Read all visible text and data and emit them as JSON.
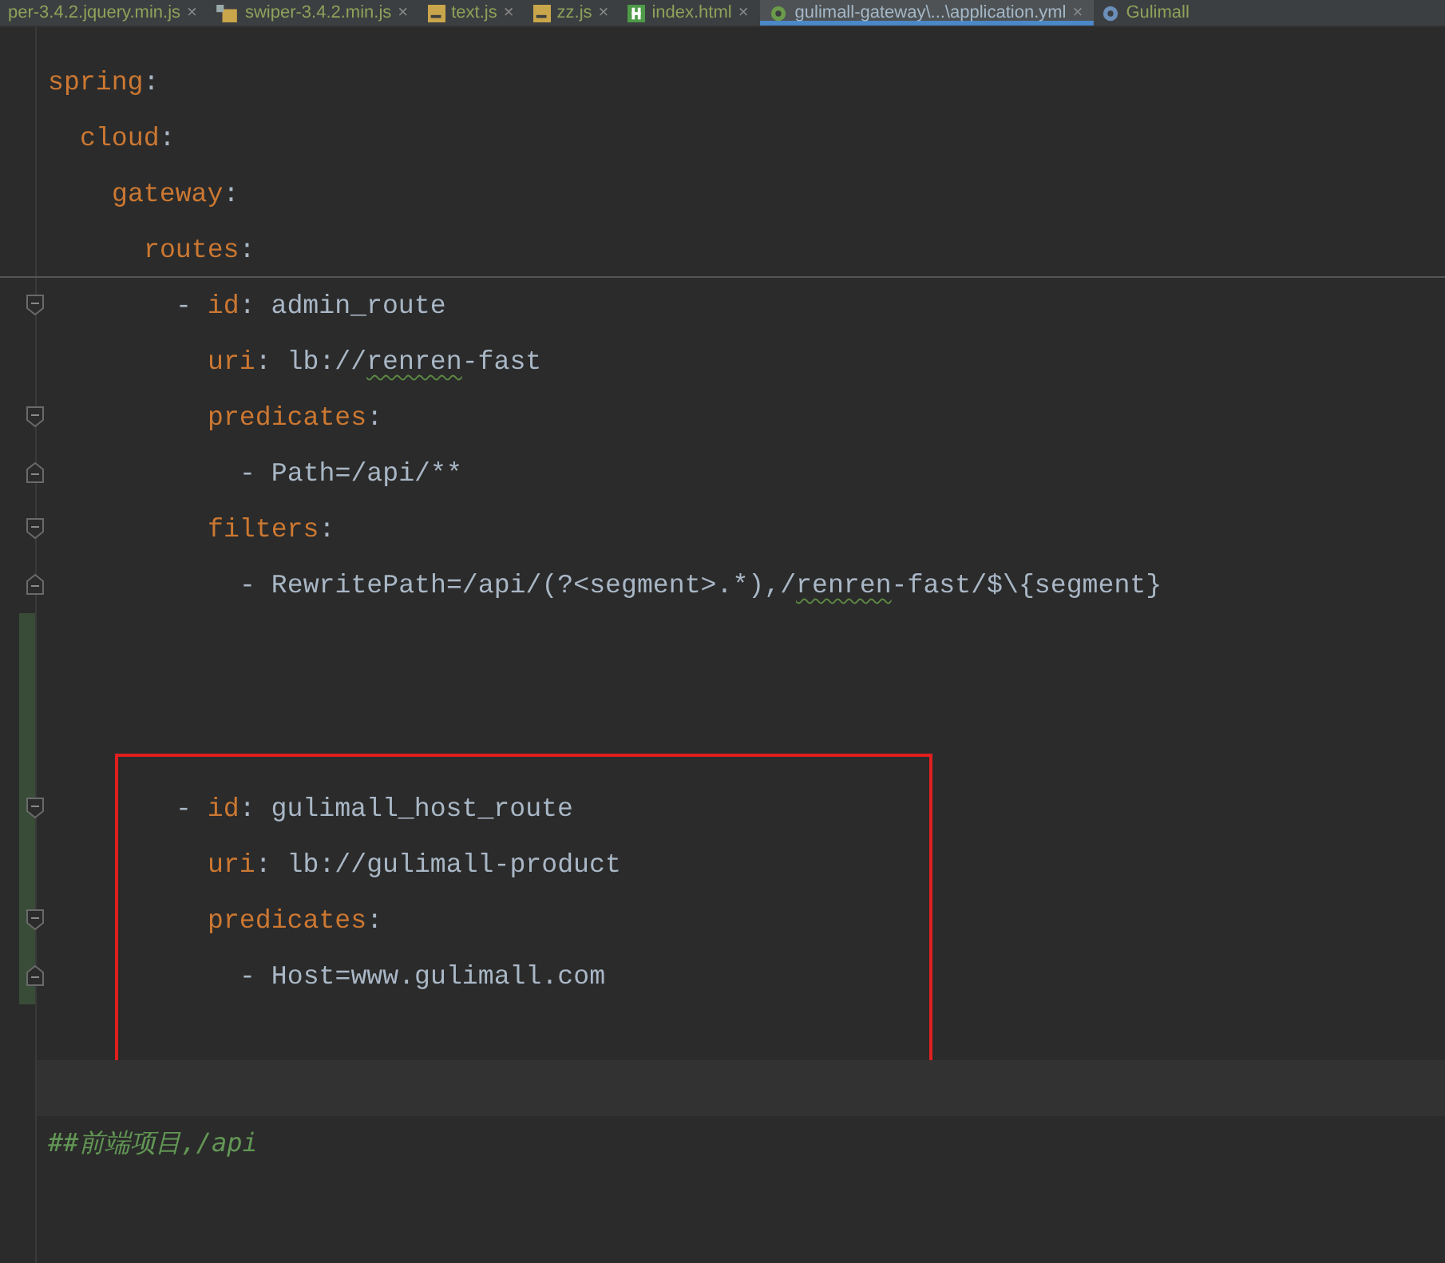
{
  "tabs": [
    {
      "label": "per-3.4.2.jquery.min.js",
      "kind": "none",
      "close": "×",
      "selected": false
    },
    {
      "label": "swiper-3.4.2.min.js",
      "kind": "minjs",
      "close": "×",
      "selected": false
    },
    {
      "label": "text.js",
      "kind": "js",
      "close": "×",
      "selected": false
    },
    {
      "label": "zz.js",
      "kind": "js",
      "close": "×",
      "selected": false
    },
    {
      "label": "index.html",
      "kind": "html",
      "close": "×",
      "selected": false
    },
    {
      "label": "gulimall-gateway\\...\\application.yml",
      "kind": "yml",
      "close": "×",
      "selected": true
    },
    {
      "label": "Gulimall",
      "kind": "app",
      "selected": false
    }
  ],
  "lines": [
    {
      "segments": [
        {
          "kind": "key",
          "text": "spring"
        },
        {
          "kind": "punct",
          "text": ":"
        }
      ],
      "children": [
        {
          "segments": [
            {
              "kind": "key",
              "text": "cloud"
            },
            {
              "kind": "punct",
              "text": ":"
            }
          ],
          "children": [
            {
              "segments": [
                {
                  "kind": "key",
                  "text": "gateway"
                },
                {
                  "kind": "punct",
                  "text": ":"
                }
              ],
              "children": [
                {
                  "segments": [
                    {
                      "kind": "key",
                      "text": "routes"
                    },
                    {
                      "kind": "punct",
                      "text": ":"
                    }
                  ],
                  "divider_below": true,
                  "children": [
                    {
                      "segments": [
                        {
                          "kind": "punct",
                          "text": "- "
                        },
                        {
                          "kind": "key",
                          "text": "id"
                        },
                        {
                          "kind": "punct",
                          "text": ": "
                        },
                        {
                          "kind": "value",
                          "text": "admin_route"
                        }
                      ],
                      "fold_start": true,
                      "children": [
                        {
                          "segments": [
                            {
                              "kind": "key",
                              "text": "uri"
                            },
                            {
                              "kind": "punct",
                              "text": ": "
                            },
                            {
                              "kind": "value",
                              "text": "lb://"
                            },
                            {
                              "kind": "typo",
                              "text": "renren"
                            },
                            {
                              "kind": "value",
                              "text": "-fast"
                            }
                          ]
                        },
                        {
                          "segments": [
                            {
                              "kind": "key",
                              "text": "predicates"
                            },
                            {
                              "kind": "punct",
                              "text": ":"
                            }
                          ],
                          "fold_start": true,
                          "children": [
                            {
                              "segments": [
                                {
                                  "kind": "punct",
                                  "text": "- "
                                },
                                {
                                  "kind": "value",
                                  "text": "Path=/api/**"
                                }
                              ],
                              "fold_end": true
                            }
                          ]
                        },
                        {
                          "segments": [
                            {
                              "kind": "key",
                              "text": "filters"
                            },
                            {
                              "kind": "punct",
                              "text": ":"
                            }
                          ],
                          "fold_start": true,
                          "children": [
                            {
                              "segments": [
                                {
                                  "kind": "punct",
                                  "text": "- "
                                },
                                {
                                  "kind": "value",
                                  "text": "RewritePath=/api/(?<segment>.*),/"
                                },
                                {
                                  "kind": "typo",
                                  "text": "renren"
                                },
                                {
                                  "kind": "value",
                                  "text": "-fast/$\\{segment}"
                                }
                              ],
                              "fold_end": true
                            }
                          ]
                        }
                      ]
                    },
                    {
                      "changed": true
                    },
                    {
                      "changed": true
                    },
                    {
                      "changed": true
                    },
                    {
                      "segments": [
                        {
                          "kind": "punct",
                          "text": "- "
                        },
                        {
                          "kind": "key",
                          "text": "id"
                        },
                        {
                          "kind": "punct",
                          "text": ": "
                        },
                        {
                          "kind": "value",
                          "text": "gulimall_host_route"
                        }
                      ],
                      "fold_start": true,
                      "changed": true,
                      "boxed": true,
                      "children": [
                        {
                          "segments": [
                            {
                              "kind": "key",
                              "text": "uri"
                            },
                            {
                              "kind": "punct",
                              "text": ": "
                            },
                            {
                              "kind": "value",
                              "text": "lb://gulimall-product"
                            }
                          ],
                          "changed": true,
                          "boxed": true
                        },
                        {
                          "segments": [
                            {
                              "kind": "key",
                              "text": "predicates"
                            },
                            {
                              "kind": "punct",
                              "text": ":"
                            }
                          ],
                          "fold_start": true,
                          "changed": true,
                          "boxed": true,
                          "children": [
                            {
                              "segments": [
                                {
                                  "kind": "punct",
                                  "text": "- "
                                },
                                {
                                  "kind": "value",
                                  "text": "Host=www.gulimall.com"
                                }
                              ],
                              "fold_end": true,
                              "changed": true,
                              "boxed": true
                            }
                          ]
                        }
                      ]
                    },
                    {
                      "boxed": true
                    },
                    {
                      "boxed": true,
                      "current": true
                    }
                  ]
                }
              ]
            }
          ]
        }
      ]
    },
    {
      "segments": [
        {
          "kind": "comment",
          "text": "##前端项目,/api"
        }
      ]
    }
  ]
}
